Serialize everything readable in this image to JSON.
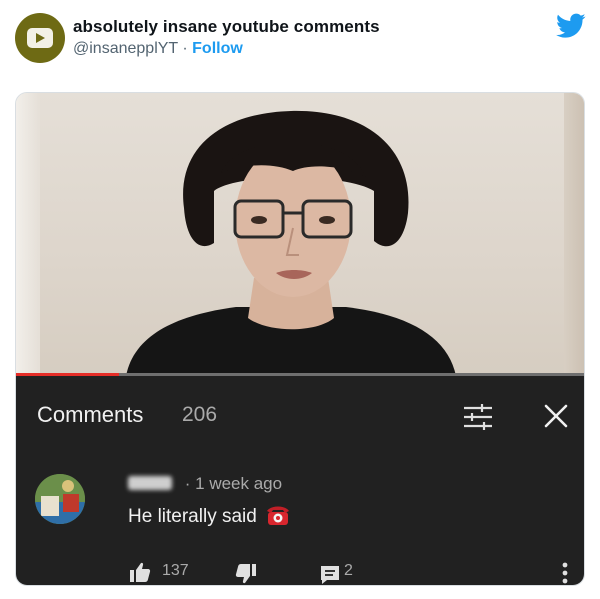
{
  "tweet": {
    "display_name": "absolutely insane youtube comments",
    "handle": "@insanepplYT",
    "separator": "·",
    "follow_label": "Follow"
  },
  "video": {
    "progress_fraction": 0.18
  },
  "comments_panel": {
    "title": "Comments",
    "count": "206",
    "comment": {
      "time_prefix": "·",
      "time": "1 week ago",
      "text": "He literally said",
      "likes": "137",
      "replies": "2"
    }
  },
  "colors": {
    "twitter_blue": "#1d9bf0",
    "panel_bg": "#212121",
    "progress_red": "#e52d27"
  }
}
